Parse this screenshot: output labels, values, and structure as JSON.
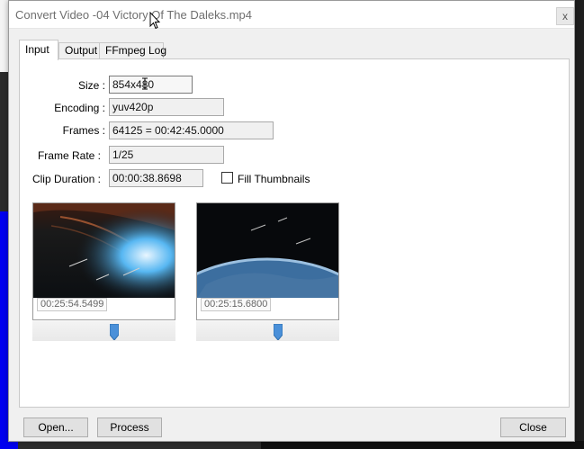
{
  "window": {
    "title": "Convert Video -04 Victory Of The Daleks.mp4",
    "close_glyph": "x"
  },
  "tabs": [
    {
      "label": "Input",
      "active": true
    },
    {
      "label": "Output",
      "active": false
    },
    {
      "label": "FFmpeg Log",
      "active": false
    }
  ],
  "fields": {
    "size": {
      "label": "Size :",
      "value": "854x480"
    },
    "encoding": {
      "label": "Encoding :",
      "value": "yuv420p"
    },
    "frames": {
      "label": "Frames :",
      "value": "64125 = 00:42:45.0000"
    },
    "frame_rate": {
      "label": "Frame Rate :",
      "value": "1/25"
    },
    "clip_duration": {
      "label": "Clip Duration :",
      "value": "00:00:38.8698"
    }
  },
  "fill_thumbnails": {
    "label": "Fill Thumbnails",
    "checked": false
  },
  "thumbnails": [
    {
      "timestamp": "00:25:54.5499",
      "icon": "video-frame-dalek-ship"
    },
    {
      "timestamp": "00:25:15.6800",
      "icon": "video-frame-earth-orbit"
    }
  ],
  "buttons": {
    "open": "Open...",
    "process": "Process",
    "close": "Close"
  },
  "colors": {
    "slider_thumb": "#4a90d9",
    "desktop_blue": "#0000f0"
  }
}
